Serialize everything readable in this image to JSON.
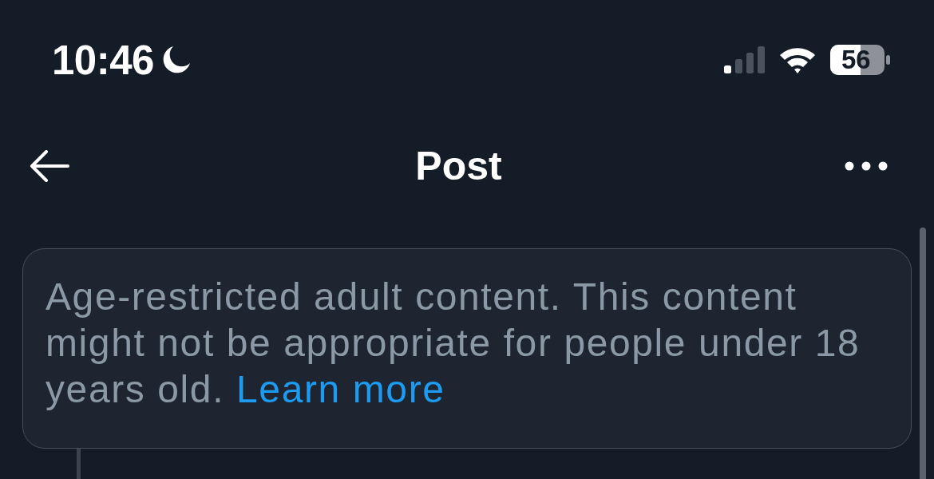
{
  "status_bar": {
    "time": "10:46",
    "battery": "56"
  },
  "header": {
    "title": "Post"
  },
  "notice": {
    "text": "Age-restricted adult content. This content might not be appropriate for people under 18 years old.",
    "link": "Learn more"
  }
}
